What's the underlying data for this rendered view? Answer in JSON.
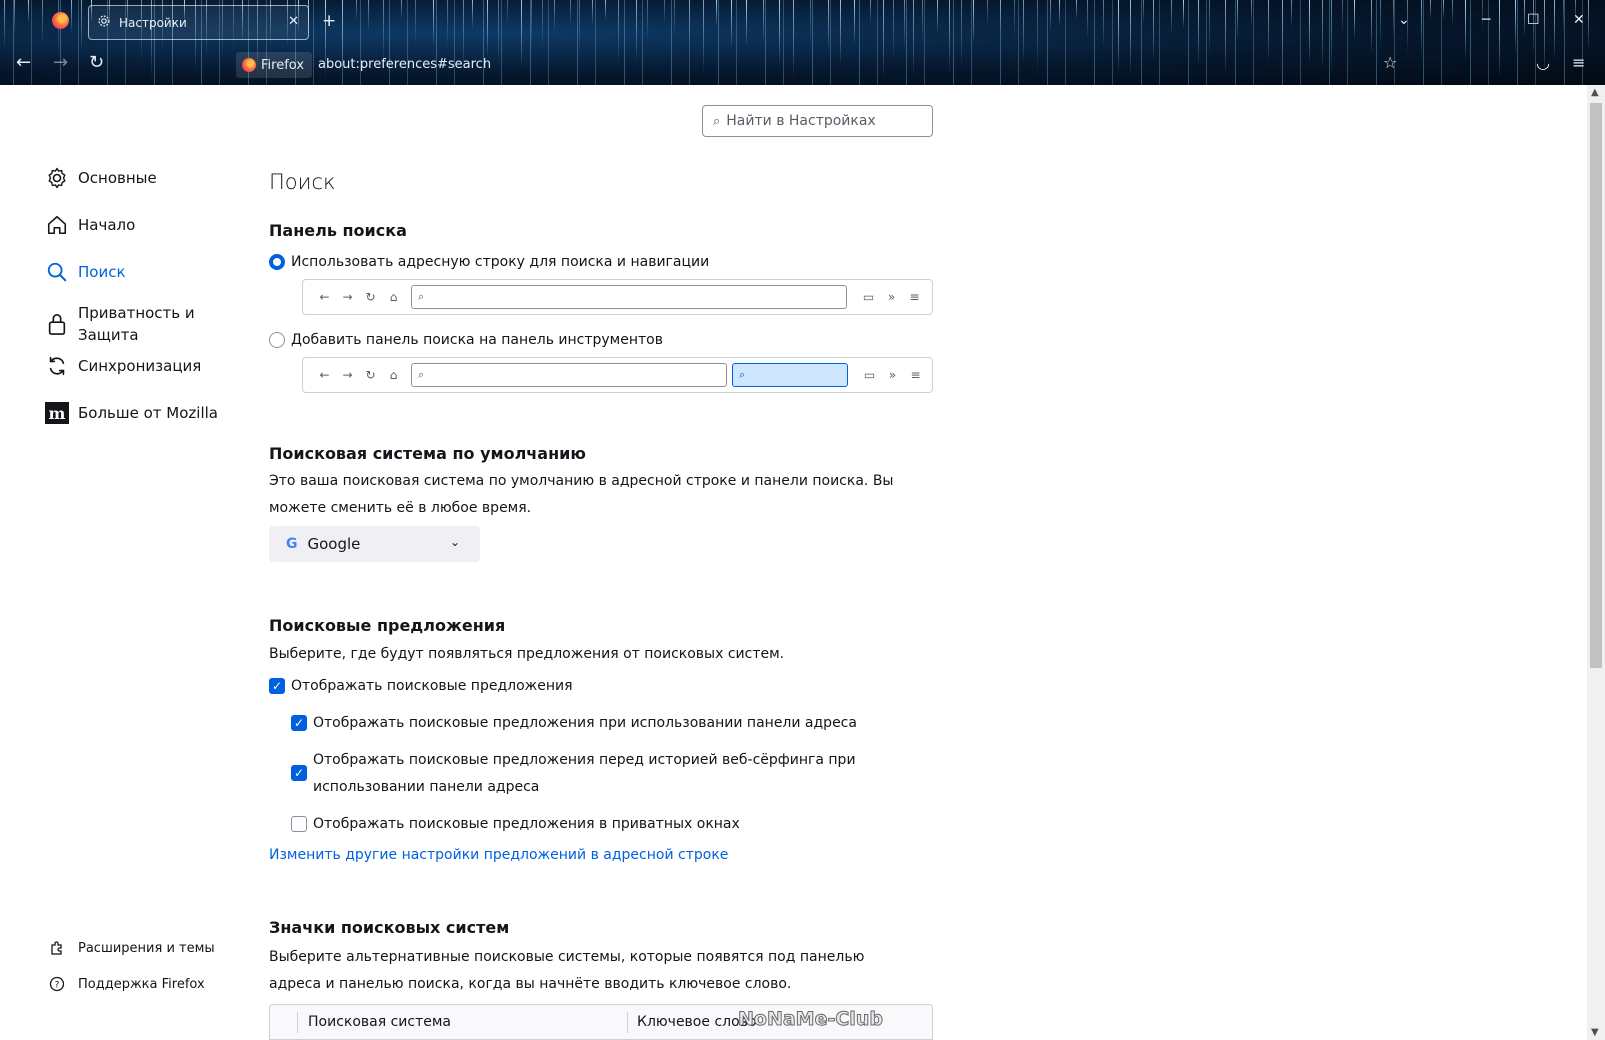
{
  "browser": {
    "tab_title": "Настройки",
    "identity_label": "Firefox",
    "url": "about:preferences#search"
  },
  "settings_search": {
    "placeholder": "Найти в Настройках"
  },
  "sidebar": {
    "items": [
      {
        "label": "Основные",
        "icon": "gear-icon"
      },
      {
        "label": "Начало",
        "icon": "home-icon"
      },
      {
        "label": "Поиск",
        "icon": "search-icon",
        "active": true
      },
      {
        "label": "Приватность и Защита",
        "icon": "lock-icon"
      },
      {
        "label": "Синхронизация",
        "icon": "sync-icon"
      },
      {
        "label": "Больше от Mozilla",
        "icon": "mozilla-icon"
      }
    ],
    "footer": [
      {
        "label": "Расширения и темы",
        "icon": "puzzle-icon"
      },
      {
        "label": "Поддержка Firefox",
        "icon": "help-icon"
      }
    ]
  },
  "main": {
    "page_title": "Поиск",
    "search_bar": {
      "heading": "Панель поиска",
      "option_urlbar": "Использовать адресную строку для поиска и навигации",
      "option_searchbar": "Добавить панель поиска на панель инструментов",
      "selected": "urlbar"
    },
    "default_engine": {
      "heading": "Поисковая система по умолчанию",
      "description": "Это ваша поисковая система по умолчанию в адресной строке и панели поиска. Вы можете сменить её в любое время.",
      "selected": "Google"
    },
    "suggestions": {
      "heading": "Поисковые предложения",
      "description": "Выберите, где будут появляться предложения от поисковых систем.",
      "show_suggestions": {
        "label": "Отображать поисковые предложения",
        "checked": true
      },
      "in_address_bar": {
        "label": "Отображать поисковые предложения при использовании панели адреса",
        "checked": true
      },
      "before_history": {
        "label": "Отображать поисковые предложения перед историей веб-сёрфинга при использовании панели адреса",
        "checked": true
      },
      "in_private": {
        "label": "Отображать поисковые предложения в приватных окнах",
        "checked": false
      },
      "other_settings_link": "Изменить другие настройки предложений в адресной строке"
    },
    "shortcuts": {
      "heading": "Значки поисковых систем",
      "description": "Выберите альтернативные поисковые системы, которые появятся под панелью адреса и панелью поиска, когда вы начнёте вводить ключевое слово.",
      "columns": [
        "Поисковая система",
        "Ключевое слово"
      ]
    }
  },
  "watermark": "NoNaMe-Club",
  "colors": {
    "accent": "#0061e0",
    "text": "#15141a"
  }
}
